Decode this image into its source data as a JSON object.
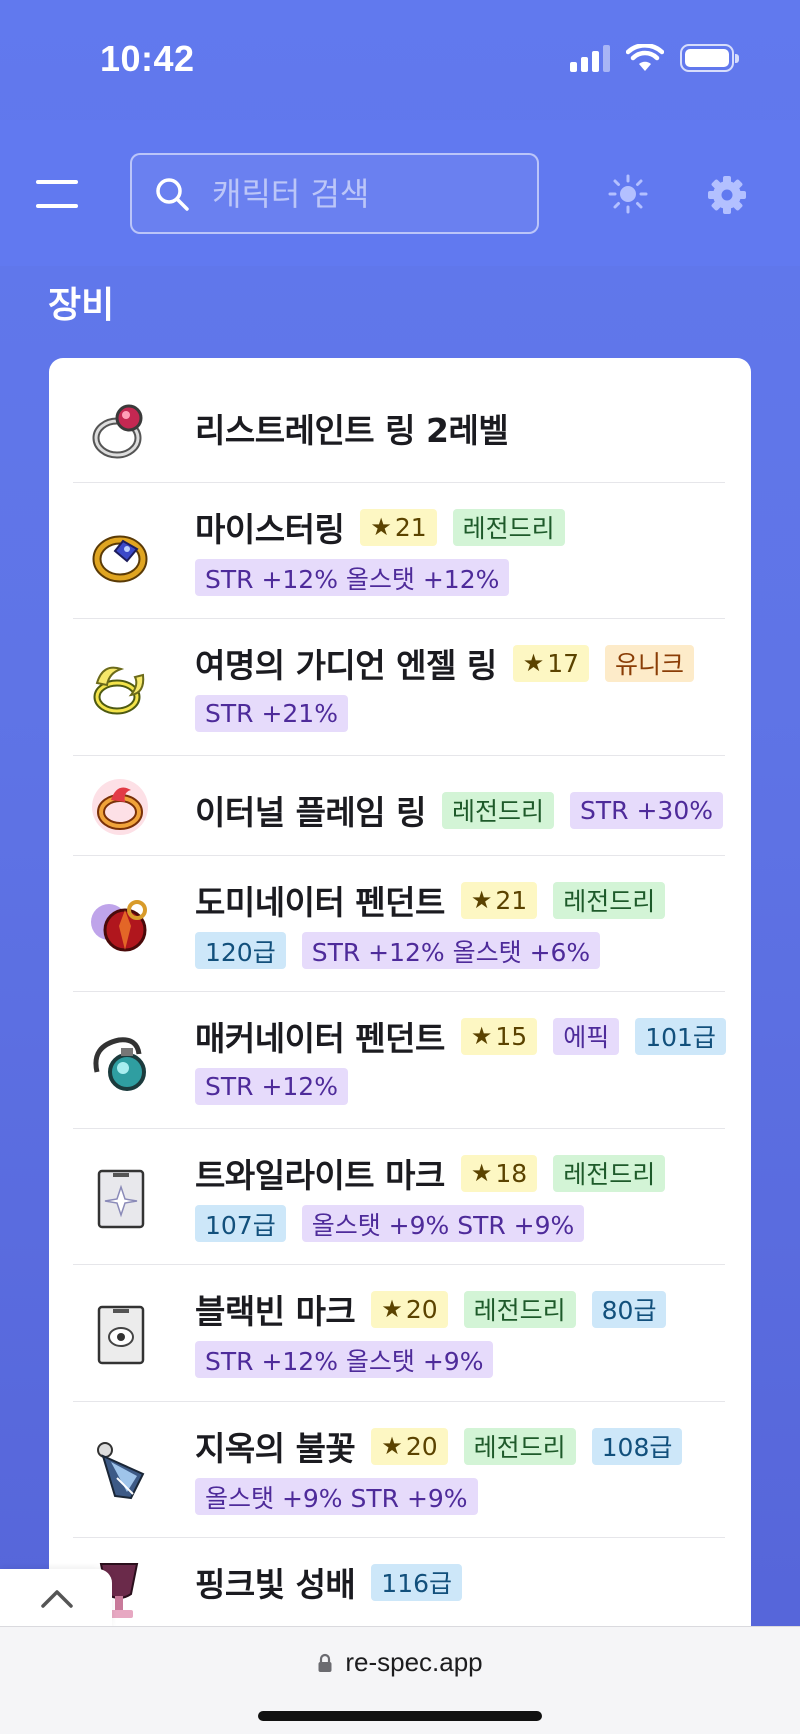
{
  "status_bar": {
    "time": "10:42"
  },
  "header": {
    "search_placeholder": "캐릭터 검색"
  },
  "section": {
    "title": "장비"
  },
  "items": [
    {
      "name": "리스트레인트 링 2레벨",
      "icon": "restraint-ring-icon",
      "line1": [],
      "line2": []
    },
    {
      "name": "마이스터링",
      "icon": "meister-ring-icon",
      "line1": [
        {
          "type": "star",
          "text": "21"
        },
        {
          "type": "legendary",
          "text": "레전드리"
        }
      ],
      "line2": [
        {
          "type": "stat",
          "text": "STR +12% 올스탯 +12%"
        }
      ]
    },
    {
      "name": "여명의 가디언 엔젤 링",
      "icon": "guardian-angel-ring-icon",
      "line1": [
        {
          "type": "star",
          "text": "17"
        },
        {
          "type": "unique",
          "text": "유니크"
        }
      ],
      "line2": [
        {
          "type": "stat",
          "text": "STR +21%"
        }
      ]
    },
    {
      "name": "이터널 플레임 링",
      "icon": "eternal-flame-ring-icon",
      "line1": [
        {
          "type": "legendary",
          "text": "레전드리"
        },
        {
          "type": "stat",
          "text": "STR +30%"
        }
      ],
      "line2": []
    },
    {
      "name": "도미네이터 펜던트",
      "icon": "dominator-pendant-icon",
      "line1": [
        {
          "type": "star",
          "text": "21"
        },
        {
          "type": "legendary",
          "text": "레전드리"
        }
      ],
      "line2": [
        {
          "type": "level",
          "text": "120급"
        },
        {
          "type": "stat",
          "text": "STR +12% 올스탯 +6%"
        }
      ]
    },
    {
      "name": "매커네이터 펜던트",
      "icon": "mechanator-pendant-icon",
      "line1": [
        {
          "type": "star",
          "text": "15"
        },
        {
          "type": "epic",
          "text": "에픽"
        },
        {
          "type": "level",
          "text": "101급"
        }
      ],
      "line2": [
        {
          "type": "stat",
          "text": "STR +12%"
        }
      ]
    },
    {
      "name": "트와일라이트 마크",
      "icon": "twilight-mark-icon",
      "line1": [
        {
          "type": "star",
          "text": "18"
        },
        {
          "type": "legendary",
          "text": "레전드리"
        }
      ],
      "line2": [
        {
          "type": "level",
          "text": "107급"
        },
        {
          "type": "stat",
          "text": "올스탯 +9% STR +9%"
        }
      ]
    },
    {
      "name": "블랙빈 마크",
      "icon": "black-bean-mark-icon",
      "line1": [
        {
          "type": "star",
          "text": "20"
        },
        {
          "type": "legendary",
          "text": "레전드리"
        },
        {
          "type": "level",
          "text": "80급"
        }
      ],
      "line2": [
        {
          "type": "stat",
          "text": "STR +12% 올스탯 +9%"
        }
      ]
    },
    {
      "name": "지옥의 불꽃",
      "icon": "hellfire-earring-icon",
      "line1": [
        {
          "type": "star",
          "text": "20"
        },
        {
          "type": "legendary",
          "text": "레전드리"
        },
        {
          "type": "level",
          "text": "108급"
        }
      ],
      "line2": [
        {
          "type": "stat",
          "text": "올스탯 +9% STR +9%"
        }
      ]
    },
    {
      "name": "핑크빛 성배",
      "icon": "pink-holy-cup-icon",
      "line1": [
        {
          "type": "level",
          "text": "116급"
        }
      ],
      "line2": []
    }
  ],
  "browser": {
    "url": "re-spec.app"
  },
  "colors": {
    "background": "#6179ee",
    "star_badge": "#fdf7c3",
    "legendary_badge": "#d3f4d6",
    "unique_badge": "#fdebc9",
    "epic_badge": "#e6dbfb",
    "level_badge": "#cde7f9",
    "stat_badge": "#e6dbfb"
  }
}
